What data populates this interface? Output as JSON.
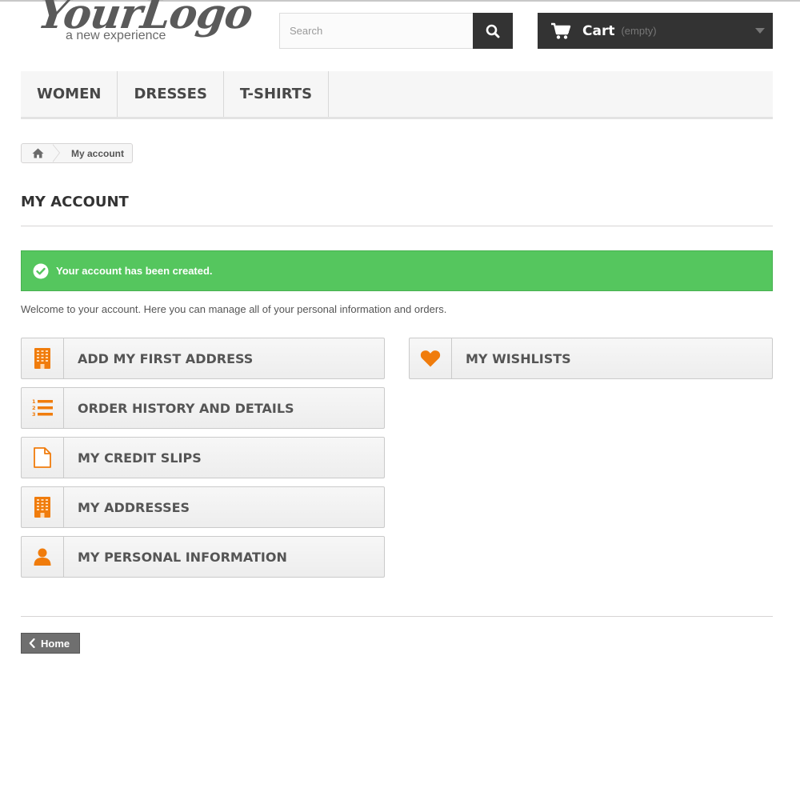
{
  "header": {
    "logo_main": "YourLogo",
    "logo_tagline": "a new experience",
    "search_placeholder": "Search",
    "cart_label": "Cart",
    "cart_status": "(empty)"
  },
  "nav": {
    "items": [
      {
        "label": "WOMEN"
      },
      {
        "label": "DRESSES"
      },
      {
        "label": "T-SHIRTS"
      }
    ]
  },
  "breadcrumb": {
    "current": "My account"
  },
  "page": {
    "title": "MY ACCOUNT",
    "alert": "Your account has been created.",
    "welcome": "Welcome to your account. Here you can manage all of your personal information and orders."
  },
  "account_links": {
    "left": [
      {
        "label": "ADD MY FIRST ADDRESS",
        "icon": "building-icon"
      },
      {
        "label": "ORDER HISTORY AND DETAILS",
        "icon": "ordered-list-icon"
      },
      {
        "label": "MY CREDIT SLIPS",
        "icon": "file-icon"
      },
      {
        "label": "MY ADDRESSES",
        "icon": "building-icon"
      },
      {
        "label": "MY PERSONAL INFORMATION",
        "icon": "user-icon"
      }
    ],
    "right": [
      {
        "label": "MY WISHLISTS",
        "icon": "heart-icon"
      }
    ]
  },
  "footer": {
    "home_label": "Home"
  },
  "colors": {
    "accent_orange": "#f07c0c",
    "success_green": "#55c65e",
    "dark": "#333333"
  }
}
